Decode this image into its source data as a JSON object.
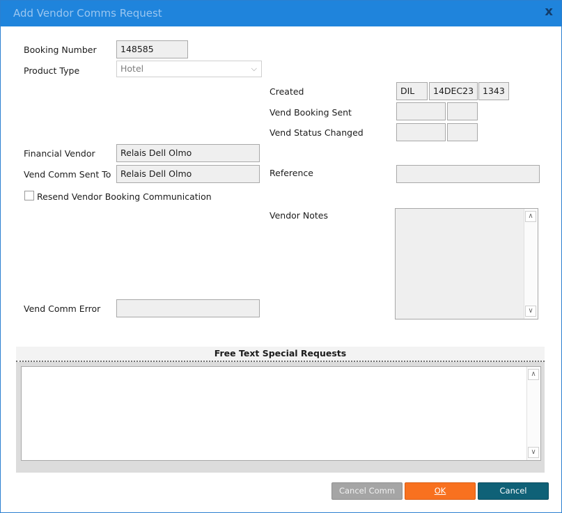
{
  "window": {
    "title": "Add Vendor Comms Request",
    "close_label": "x"
  },
  "form": {
    "booking_number_label": "Booking Number",
    "booking_number_value": "148585",
    "product_type_label": "Product Type",
    "product_type_value": "Hotel",
    "created_label": "Created",
    "created_agent": "DIL",
    "created_date": "14DEC23",
    "created_time": "1343",
    "vend_booking_sent_label": "Vend Booking Sent",
    "vend_booking_sent_date": "",
    "vend_booking_sent_time": "",
    "vend_status_changed_label": "Vend Status Changed",
    "vend_status_changed_date": "",
    "vend_status_changed_time": "",
    "financial_vendor_label": "Financial Vendor",
    "financial_vendor_value": "Relais Dell Olmo",
    "vend_comm_sent_to_label": "Vend Comm Sent To",
    "vend_comm_sent_to_value": "Relais Dell Olmo",
    "reference_label": "Reference",
    "reference_value": "",
    "resend_label": "Resend Vendor Booking Communication",
    "vendor_notes_label": "Vendor Notes",
    "vendor_notes_value": "",
    "vend_comm_error_label": "Vend Comm Error",
    "vend_comm_error_value": ""
  },
  "special_requests": {
    "header": "Free Text Special Requests",
    "value": ""
  },
  "buttons": {
    "cancel_comm": "Cancel Comm",
    "ok": "OK",
    "cancel": "Cancel"
  }
}
